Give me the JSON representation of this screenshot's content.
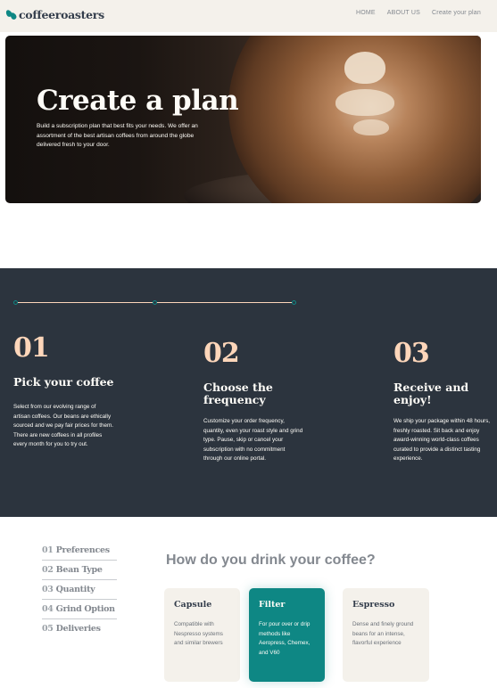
{
  "header": {
    "logo_text": "coffeeroasters",
    "nav": [
      {
        "label": "HOME"
      },
      {
        "label": "ABOUT US"
      },
      {
        "label": "Create your plan"
      }
    ]
  },
  "hero": {
    "title": "Create a plan",
    "description": "Build a subscription plan that best fits your needs. We offer an assortment of the best artisan coffees from around the globe delivered fresh to your door."
  },
  "steps": [
    {
      "number": "01",
      "title": "Pick your coffee",
      "text": "Select from our evolving range of artisan coffees. Our beans are ethically sourced and we pay fair prices for them. There are new coffees in all profiles every month for you to try out."
    },
    {
      "number": "02",
      "title": "Choose the frequency",
      "text": "Customize your order frequency, quantity, even your roast style and grind type. Pause, skip or cancel your subscription with no commitment through our online portal."
    },
    {
      "number": "03",
      "title": "Receive and enjoy!",
      "text": "We ship your package within 48 hours, freshly roasted. Sit back and enjoy award-winning world-class coffees curated to provide a distinct tasting experience."
    }
  ],
  "plan": {
    "nav": [
      {
        "num": "01",
        "label": "Preferences"
      },
      {
        "num": "02",
        "label": "Bean Type"
      },
      {
        "num": "03",
        "label": "Quantity"
      },
      {
        "num": "04",
        "label": "Grind Option"
      },
      {
        "num": "05",
        "label": "Deliveries"
      }
    ],
    "question": "How do you drink your coffee?",
    "options": [
      {
        "title": "Capsule",
        "desc": "Compatible with Nespresso systems and similar brewers",
        "selected": false
      },
      {
        "title": "Filter",
        "desc": "For pour over or drip methods like Aeropress, Chemex, and V60",
        "selected": true
      },
      {
        "title": "Espresso",
        "desc": "Dense and finely ground beans for an intense, flavorful experience",
        "selected": false
      }
    ]
  },
  "colors": {
    "accent": "#0e8784",
    "dark": "#2c343e",
    "peach": "#fdd6ba",
    "cream": "#f4f1eb"
  }
}
